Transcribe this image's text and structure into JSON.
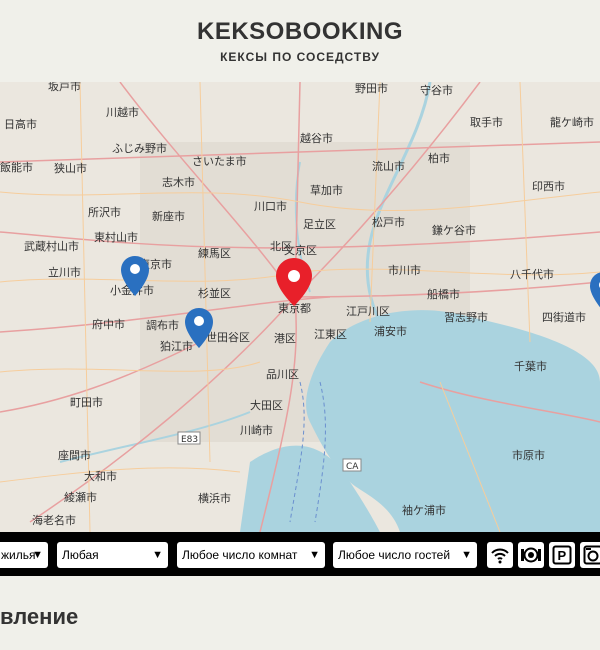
{
  "header": {
    "logo": "KEKSOBOOKING",
    "tagline": "КЕКСЫ ПО СОСЕДСТВУ"
  },
  "map": {
    "labels": [
      {
        "text": "坂戸市"
      },
      {
        "text": "野田市"
      },
      {
        "text": "守谷市"
      },
      {
        "text": "日高市"
      },
      {
        "text": "川越市"
      },
      {
        "text": "越谷市"
      },
      {
        "text": "取手市"
      },
      {
        "text": "龍ケ崎市"
      },
      {
        "text": "ふじみ野市"
      },
      {
        "text": "さいたま市"
      },
      {
        "text": "流山市"
      },
      {
        "text": "柏市"
      },
      {
        "text": "飯能市"
      },
      {
        "text": "狭山市"
      },
      {
        "text": "志木市"
      },
      {
        "text": "草加市"
      },
      {
        "text": "印西市"
      },
      {
        "text": "所沢市"
      },
      {
        "text": "新座市"
      },
      {
        "text": "川口市"
      },
      {
        "text": "足立区"
      },
      {
        "text": "松戸市"
      },
      {
        "text": "鎌ケ谷市"
      },
      {
        "text": "武蔵村山市"
      },
      {
        "text": "東村山市"
      },
      {
        "text": "練馬区"
      },
      {
        "text": "北区"
      },
      {
        "text": "立川市"
      },
      {
        "text": "西東京市"
      },
      {
        "text": "市川市"
      },
      {
        "text": "八千代市"
      },
      {
        "text": "小金井市"
      },
      {
        "text": "杉並区"
      },
      {
        "text": "府中市"
      },
      {
        "text": "調布市"
      },
      {
        "text": "世田谷区"
      },
      {
        "text": "東京都"
      },
      {
        "text": "江戸川区"
      },
      {
        "text": "船橋市"
      },
      {
        "text": "習志野市"
      },
      {
        "text": "四街道市"
      },
      {
        "text": "狛江市"
      },
      {
        "text": "港区"
      },
      {
        "text": "江東区"
      },
      {
        "text": "浦安市"
      },
      {
        "text": "品川区"
      },
      {
        "text": "千葉市"
      },
      {
        "text": "町田市"
      },
      {
        "text": "大田区"
      },
      {
        "text": "川崎市"
      },
      {
        "text": "座間市"
      },
      {
        "text": "大和市"
      },
      {
        "text": "綾瀬市"
      },
      {
        "text": "横浜市"
      },
      {
        "text": "海老名市"
      },
      {
        "text": "袖ケ浦市"
      },
      {
        "text": "市原市"
      },
      {
        "text": "文京区"
      },
      {
        "text": "E83"
      },
      {
        "text": "CA"
      }
    ]
  },
  "filters": {
    "housing_type": "жилья",
    "price": "Любая",
    "rooms": "Любое число комнат",
    "guests": "Любое число гостей",
    "features": [
      "wifi-icon",
      "dishwasher-icon",
      "parking-icon",
      "washer-icon"
    ]
  },
  "section": {
    "title": "вление"
  },
  "colors": {
    "main_pin": "#e8202a",
    "offer_pin": "#2a70c0",
    "water": "#aad3df",
    "filter_bar": "#000000"
  }
}
